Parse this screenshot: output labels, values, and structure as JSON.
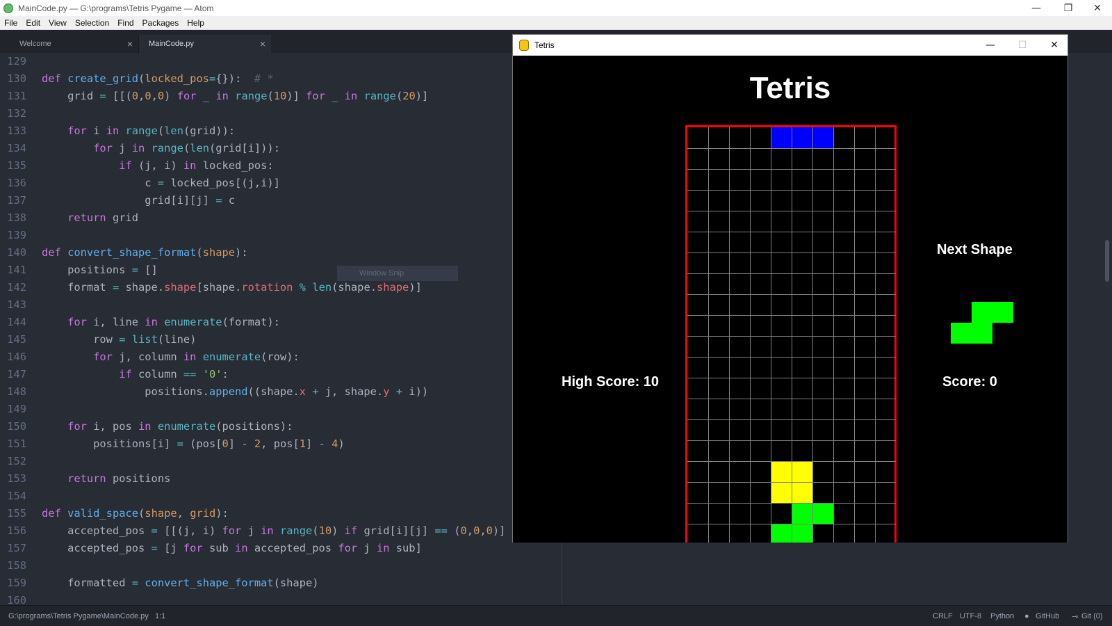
{
  "window": {
    "title": "MainCode.py — G:\\programs\\Tetris Pygame — Atom",
    "minimize": "—",
    "restore": "❐",
    "close": "✕"
  },
  "menu": [
    "File",
    "Edit",
    "View",
    "Selection",
    "Find",
    "Packages",
    "Help"
  ],
  "tabs": [
    {
      "label": "Welcome",
      "close": "×"
    },
    {
      "label": "MainCode.py",
      "close": "×"
    }
  ],
  "code_lines": [
    {
      "n": "129",
      "html": ""
    },
    {
      "n": "130",
      "html": "<span class='kw'>def</span> <span class='fn'>create_grid</span>(<span class='param'>locked_pos</span><span class='op'>=</span>{}):  <span class='cm'># *</span>"
    },
    {
      "n": "131",
      "html": "    grid <span class='op'>=</span> [[(<span class='num'>0</span>,<span class='num'>0</span>,<span class='num'>0</span>) <span class='kw'>for</span> _ <span class='kw'>in</span> <span class='bi'>range</span>(<span class='num'>10</span>)] <span class='kw'>for</span> _ <span class='kw'>in</span> <span class='bi'>range</span>(<span class='num'>20</span>)]"
    },
    {
      "n": "132",
      "html": ""
    },
    {
      "n": "133",
      "html": "    <span class='kw'>for</span> i <span class='kw'>in</span> <span class='bi'>range</span>(<span class='bi'>len</span>(grid)):"
    },
    {
      "n": "134",
      "html": "        <span class='kw'>for</span> j <span class='kw'>in</span> <span class='bi'>range</span>(<span class='bi'>len</span>(grid[i])):"
    },
    {
      "n": "135",
      "html": "            <span class='kw'>if</span> (j, i) <span class='kw'>in</span> locked_pos:"
    },
    {
      "n": "136",
      "html": "                c <span class='op'>=</span> locked_pos[(j,i)]"
    },
    {
      "n": "137",
      "html": "                grid[i][j] <span class='op'>=</span> c"
    },
    {
      "n": "138",
      "html": "    <span class='kw'>return</span> grid"
    },
    {
      "n": "139",
      "html": ""
    },
    {
      "n": "140",
      "html": "<span class='kw'>def</span> <span class='fn'>convert_shape_format</span>(<span class='param'>shape</span>):"
    },
    {
      "n": "141",
      "html": "    positions <span class='op'>=</span> []"
    },
    {
      "n": "142",
      "html": "    format <span class='op'>=</span> shape.<span class='attr'>shape</span>[shape.<span class='attr'>rotation</span> <span class='op'>%</span> <span class='bi'>len</span>(shape.<span class='attr'>shape</span>)]"
    },
    {
      "n": "143",
      "html": ""
    },
    {
      "n": "144",
      "html": "    <span class='kw'>for</span> i, line <span class='kw'>in</span> <span class='bi'>enumerate</span>(format):"
    },
    {
      "n": "145",
      "html": "        row <span class='op'>=</span> <span class='bi'>list</span>(line)"
    },
    {
      "n": "146",
      "html": "        <span class='kw'>for</span> j, column <span class='kw'>in</span> <span class='bi'>enumerate</span>(row):"
    },
    {
      "n": "147",
      "html": "            <span class='kw'>if</span> column <span class='op'>==</span> <span class='str'>'0'</span>:"
    },
    {
      "n": "148",
      "html": "                positions.<span class='fn'>append</span>((shape.<span class='attr'>x</span> <span class='op'>+</span> j, shape.<span class='attr'>y</span> <span class='op'>+</span> i))"
    },
    {
      "n": "149",
      "html": ""
    },
    {
      "n": "150",
      "html": "    <span class='kw'>for</span> i, pos <span class='kw'>in</span> <span class='bi'>enumerate</span>(positions):"
    },
    {
      "n": "151",
      "html": "        positions[i] <span class='op'>=</span> (pos[<span class='num'>0</span>] <span class='op'>-</span> <span class='num'>2</span>, pos[<span class='num'>1</span>] <span class='op'>-</span> <span class='num'>4</span>)"
    },
    {
      "n": "152",
      "html": ""
    },
    {
      "n": "153",
      "html": "    <span class='kw'>return</span> positions"
    },
    {
      "n": "154",
      "html": ""
    },
    {
      "n": "155",
      "html": "<span class='kw'>def</span> <span class='fn'>valid_space</span>(<span class='param'>shape</span>, <span class='param'>grid</span>):"
    },
    {
      "n": "156",
      "html": "    accepted_pos <span class='op'>=</span> [[(j, i) <span class='kw'>for</span> j <span class='kw'>in</span> <span class='bi'>range</span>(<span class='num'>10</span>) <span class='kw'>if</span> grid[i][j] <span class='op'>==</span> (<span class='num'>0</span>,<span class='num'>0</span>,<span class='num'>0</span>)]"
    },
    {
      "n": "157",
      "html": "    accepted_pos <span class='op'>=</span> [j <span class='kw'>for</span> sub <span class='kw'>in</span> accepted_pos <span class='kw'>for</span> j <span class='kw'>in</span> sub]"
    },
    {
      "n": "158",
      "html": ""
    },
    {
      "n": "159",
      "html": "    formatted <span class='op'>=</span> <span class='fn'>convert_shape_format</span>(shape)"
    },
    {
      "n": "160",
      "html": ""
    }
  ],
  "snip_label": "Window Snip",
  "status": {
    "path": "G:\\programs\\Tetris Pygame\\MainCode.py",
    "cursor": "1:1",
    "line_ending": "CRLF",
    "encoding": "UTF-8",
    "grammar": "Python",
    "github": "GitHub",
    "git": "Git (0)"
  },
  "tetris": {
    "window_title": "Tetris",
    "minimize": "—",
    "maximize": "☐",
    "close": "✕",
    "game_title": "Tetris",
    "next_label": "Next Shape",
    "score_label": "Score: 0",
    "high_score_label": "High Score: 10",
    "board_cols": 10,
    "board_rows": 20,
    "filled_cells": [
      {
        "col": 4,
        "row": 0,
        "color": "#0000ff"
      },
      {
        "col": 5,
        "row": 0,
        "color": "#0000ff"
      },
      {
        "col": 6,
        "row": 0,
        "color": "#0000ff"
      },
      {
        "col": 4,
        "row": 16,
        "color": "#ffff00"
      },
      {
        "col": 5,
        "row": 16,
        "color": "#ffff00"
      },
      {
        "col": 4,
        "row": 17,
        "color": "#ffff00"
      },
      {
        "col": 5,
        "row": 17,
        "color": "#ffff00"
      },
      {
        "col": 5,
        "row": 18,
        "color": "#00ff00"
      },
      {
        "col": 6,
        "row": 18,
        "color": "#00ff00"
      },
      {
        "col": 4,
        "row": 19,
        "color": "#00ff00"
      },
      {
        "col": 5,
        "row": 19,
        "color": "#00ff00"
      }
    ],
    "next_shape": {
      "color": "#00ff00",
      "cells": [
        [
          1,
          0
        ],
        [
          2,
          0
        ],
        [
          0,
          1
        ],
        [
          1,
          1
        ]
      ]
    }
  }
}
